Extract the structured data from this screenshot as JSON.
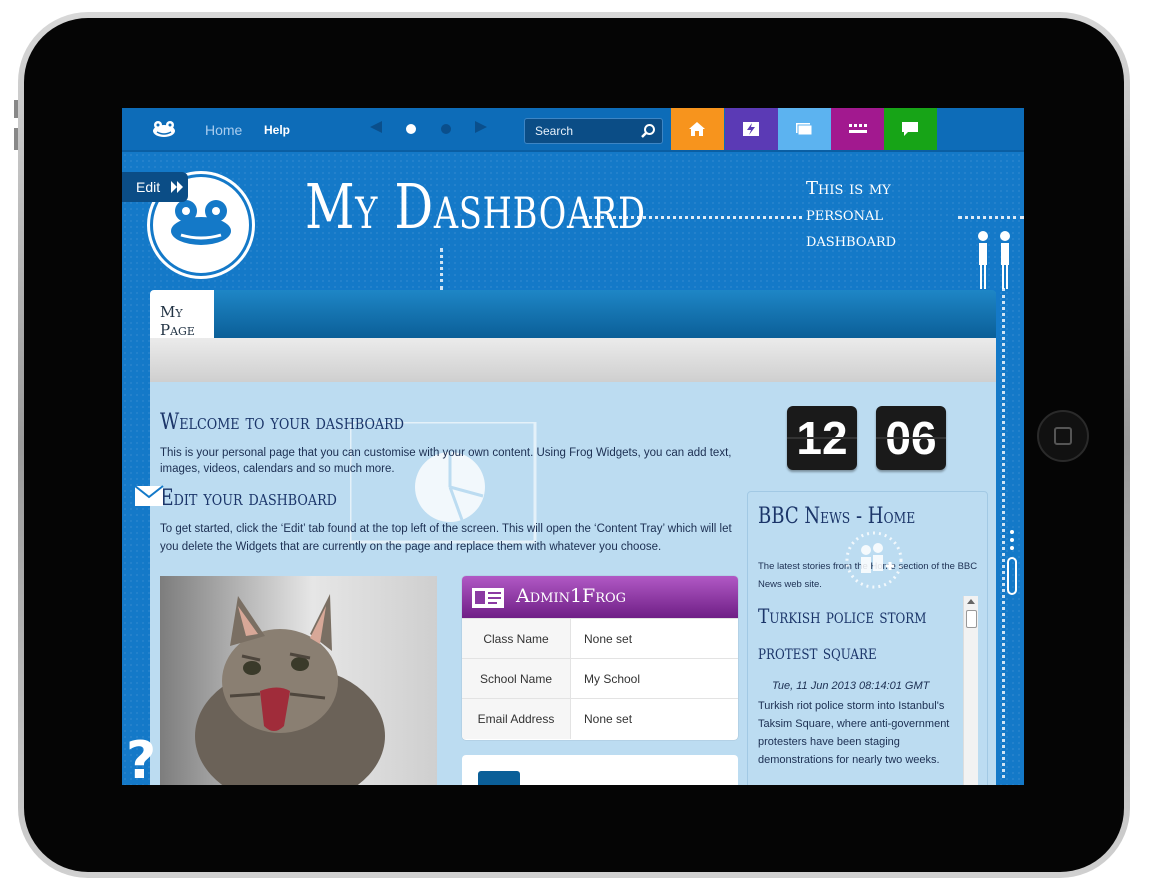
{
  "nav": {
    "home": "Home",
    "help": "Help"
  },
  "search": {
    "placeholder": "Search"
  },
  "apps": {
    "tiles": [
      {
        "name": "home-icon",
        "color": "#f7941d"
      },
      {
        "name": "lightning-icon",
        "color": "#5b3ab5"
      },
      {
        "name": "folder-icon",
        "color": "#5cb3f0"
      },
      {
        "name": "keyboard-icon",
        "color": "#a2198f"
      },
      {
        "name": "chat-icon",
        "color": "#17a417"
      }
    ]
  },
  "edit": {
    "label": "Edit"
  },
  "header": {
    "title": "My Dashboard",
    "subtitle": "This is my personal dashboard"
  },
  "page_tab": {
    "label": "My Page"
  },
  "welcome": {
    "heading": "Welcome to your dashboard",
    "text": "This is your personal page that you can customise with your own content. Using Frog Widgets, you can add text, images, videos, calendars and so much more."
  },
  "edit_section": {
    "heading": "Edit your dashboard",
    "text": "To get started, click the ‘Edit’ tab found at the top left of the screen. This will open the ‘Content Tray’ which will let you delete the Widgets that are currently on the page and replace them with whatever you choose."
  },
  "clock": {
    "hours": "12",
    "minutes": "06"
  },
  "profile": {
    "name": "Admin1Frog",
    "rows": [
      {
        "key": "Class Name",
        "value": "None set"
      },
      {
        "key": "School Name",
        "value": "My School"
      },
      {
        "key": "Email Address",
        "value": "None set"
      }
    ]
  },
  "news": {
    "title": "BBC News - Home",
    "description": "The latest stories from the Home section of the BBC News web site.",
    "headline": "Turkish police storm protest square",
    "date": "Tue, 11 Jun 2013 08:14:01 GMT",
    "body": "Turkish riot police storm into Istanbul's Taksim Square, where anti-government protesters have been staging demonstrations for nearly two weeks."
  },
  "colors": {
    "accent": "#1479c8",
    "topbar": "#0d6cb8",
    "heading": "#1b3569",
    "profile": "#8b3aa3"
  }
}
